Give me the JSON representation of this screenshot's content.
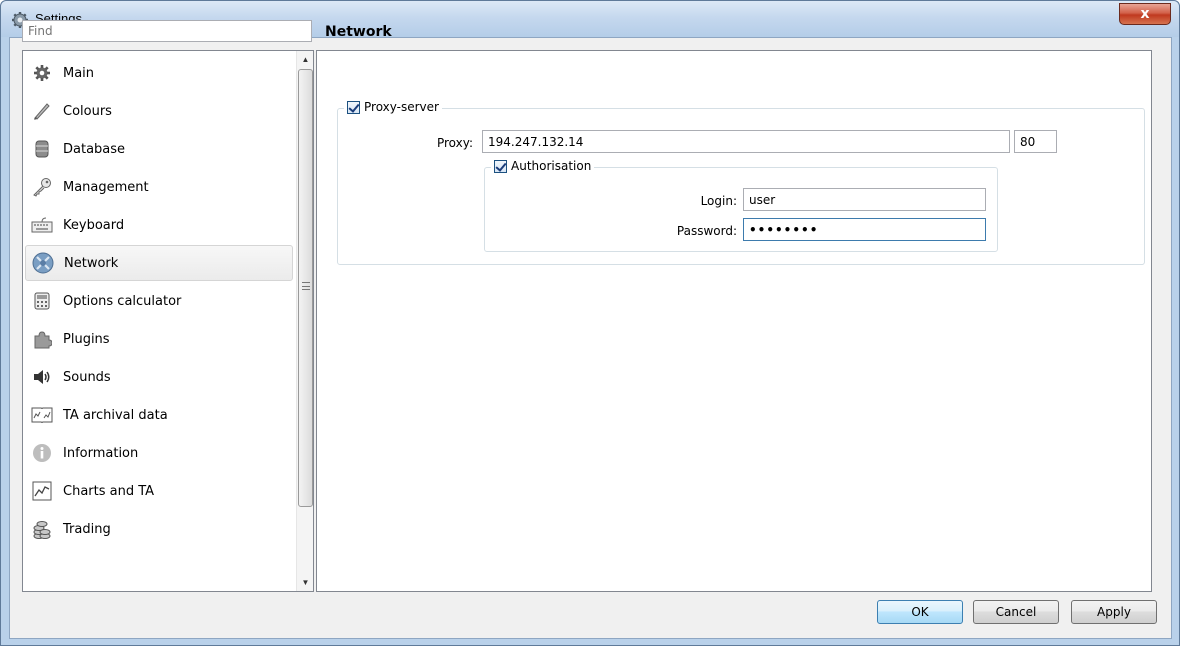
{
  "window": {
    "title": "Settings",
    "close_label": "x"
  },
  "search": {
    "placeholder": "Find"
  },
  "sidebar": {
    "items": [
      {
        "label": "Main",
        "icon": "gear-icon"
      },
      {
        "label": "Colours",
        "icon": "brush-icon"
      },
      {
        "label": "Database",
        "icon": "database-icon"
      },
      {
        "label": "Management",
        "icon": "key-icon"
      },
      {
        "label": "Keyboard",
        "icon": "keyboard-icon"
      },
      {
        "label": "Network",
        "icon": "network-icon",
        "selected": true
      },
      {
        "label": "Options calculator",
        "icon": "calculator-icon"
      },
      {
        "label": "Plugins",
        "icon": "puzzle-icon"
      },
      {
        "label": "Sounds",
        "icon": "speaker-icon"
      },
      {
        "label": "TA archival data",
        "icon": "book-chart-icon"
      },
      {
        "label": "Information",
        "icon": "info-icon"
      },
      {
        "label": "Charts and TA",
        "icon": "line-chart-icon"
      },
      {
        "label": "Trading",
        "icon": "coins-icon"
      }
    ]
  },
  "main": {
    "section_title": "Network",
    "proxy_server": {
      "label": "Proxy-server",
      "checked": true,
      "proxy_label": "Proxy:",
      "proxy_value": "194.247.132.14",
      "port_separator": ":",
      "port_value": "80"
    },
    "authorisation": {
      "label": "Authorisation",
      "checked": true,
      "login_label": "Login:",
      "login_value": "user",
      "password_label": "Password:",
      "password_value": "••••••••"
    }
  },
  "buttons": {
    "ok": "OK",
    "cancel": "Cancel",
    "apply": "Apply"
  },
  "colors": {
    "accent": "#3c7fb1",
    "selection": "#ebebeb"
  }
}
